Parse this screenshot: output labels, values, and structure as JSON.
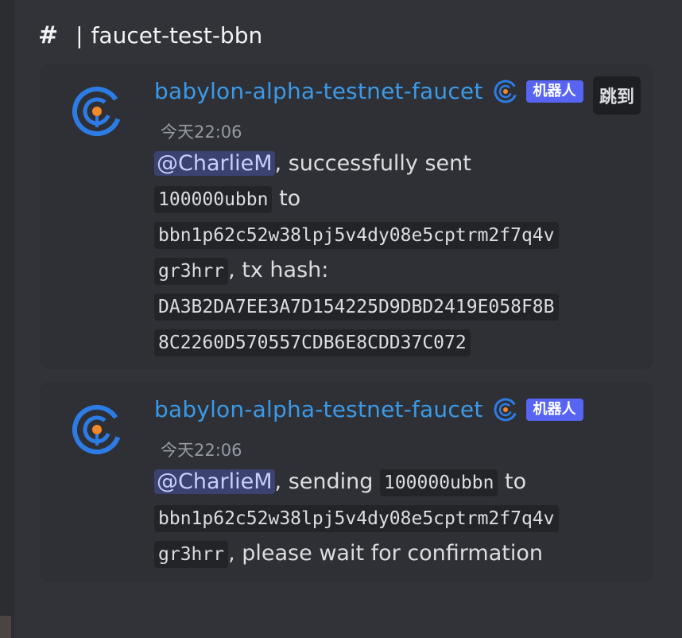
{
  "channel": {
    "hash_symbol": "#",
    "separator": "|",
    "name": "faucet-test-bbn"
  },
  "colors": {
    "background": "#313338",
    "message_bg": "#2e3035",
    "author": "#3b9ae8",
    "bot_tag": "#5865f2",
    "mention_bg": "#3c4270",
    "avatar_ring": "#2d7ce6",
    "avatar_dot": "#f2892a"
  },
  "messages": [
    {
      "author": "babylon-alpha-testnet-faucet",
      "verified_icon": "babylon-logo-icon",
      "bot_tag": "机器人",
      "jump_label": "跳到",
      "timestamp": "今天22:06",
      "mention": "@CharlieM",
      "text1": ", successfully sent",
      "code_amount": "100000ubbn",
      "text2": " to",
      "code_addr_line1": "bbn1p62c52w38lpj5v4dy08e5cptrm2f7q4v",
      "code_addr_line2": "gr3hrr",
      "text3": ", tx hash:",
      "code_hash_line1": "DA3B2DA7EE3A7D154225D9DBD2419E058F8B",
      "code_hash_line2": "8C2260D570557CDB6E8CDD37C072"
    },
    {
      "author": "babylon-alpha-testnet-faucet",
      "verified_icon": "babylon-logo-icon",
      "bot_tag": "机器人",
      "timestamp": "今天22:06",
      "mention": "@CharlieM",
      "text1": ", sending ",
      "code_amount": "100000ubbn",
      "text2": " to",
      "code_addr_line1": "bbn1p62c52w38lpj5v4dy08e5cptrm2f7q4v",
      "code_addr_line2": "gr3hrr",
      "text3": ", please wait for confirmation"
    }
  ]
}
